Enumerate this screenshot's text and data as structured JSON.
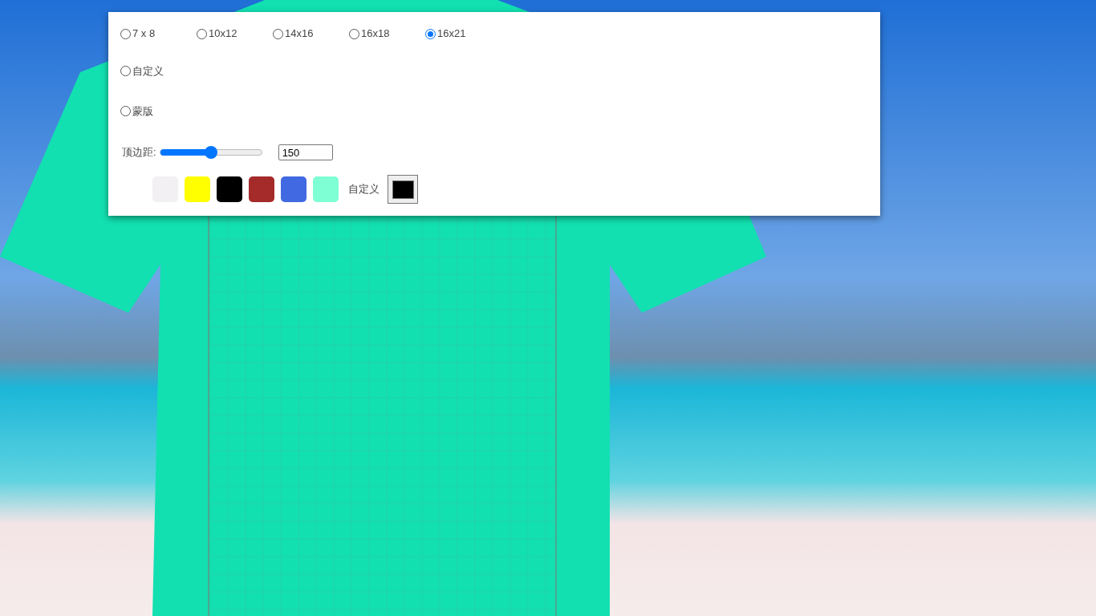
{
  "size_options": [
    {
      "label": "7 x 8",
      "selected": false
    },
    {
      "label": "10x12",
      "selected": false
    },
    {
      "label": "14x16",
      "selected": false
    },
    {
      "label": "16x18",
      "selected": false
    },
    {
      "label": "16x21",
      "selected": true
    }
  ],
  "custom_option": {
    "label": "自定义",
    "selected": false
  },
  "mask_option": {
    "label": "蒙版",
    "selected": false
  },
  "top_margin": {
    "label": "顶边距:",
    "level": 0.5,
    "value": "150"
  },
  "swatches": [
    {
      "color": "#f3f0f3"
    },
    {
      "color": "#ffff00"
    },
    {
      "color": "#000000"
    },
    {
      "color": "#a52a2a"
    },
    {
      "color": "#4169e1"
    },
    {
      "color": "#7fffd4"
    }
  ],
  "custom_color": {
    "label": "自定义",
    "color": "#000000"
  }
}
